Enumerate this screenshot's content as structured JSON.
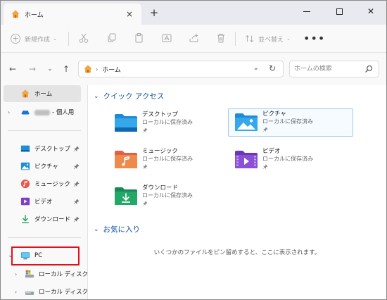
{
  "tab": {
    "title": "ホーム",
    "close": "×",
    "new": "+"
  },
  "toolbar": {
    "new_label": "新規作成",
    "sort_label": "並べ替え",
    "more": "•••"
  },
  "address": {
    "separator": "›",
    "path": "ホーム"
  },
  "search": {
    "placeholder": "ホームの検索"
  },
  "sidebar": {
    "home": "ホーム",
    "cloud": "- 個人用",
    "quick": [
      {
        "label": "デスクトップ"
      },
      {
        "label": "ピクチャ"
      },
      {
        "label": "ミュージック"
      },
      {
        "label": "ビデオ"
      },
      {
        "label": "ダウンロード"
      }
    ],
    "pc": "PC",
    "drives": [
      "ローカル ディスク",
      "ローカル ディスク"
    ]
  },
  "quick_access": {
    "header": "クイック アクセス",
    "folders": [
      {
        "name": "デスクトップ",
        "sub": "ローカルに保存済み",
        "icon": "desktop-folder-icon"
      },
      {
        "name": "ピクチャ",
        "sub": "ローカルに保存済み",
        "icon": "pictures-folder-icon"
      },
      {
        "name": "ミュージック",
        "sub": "ローカルに保存済み",
        "icon": "music-folder-icon"
      },
      {
        "name": "ビデオ",
        "sub": "ローカルに保存済み",
        "icon": "videos-folder-icon"
      },
      {
        "name": "ダウンロード",
        "sub": "ローカルに保存済み",
        "icon": "downloads-folder-icon"
      }
    ]
  },
  "favorites": {
    "header": "お気に入り",
    "empty_text": "いくつかのファイルをピン留めすると、ここに表示されます。"
  },
  "colors": {
    "accent": "#0d4f9a",
    "highlight": "#e0101c"
  }
}
